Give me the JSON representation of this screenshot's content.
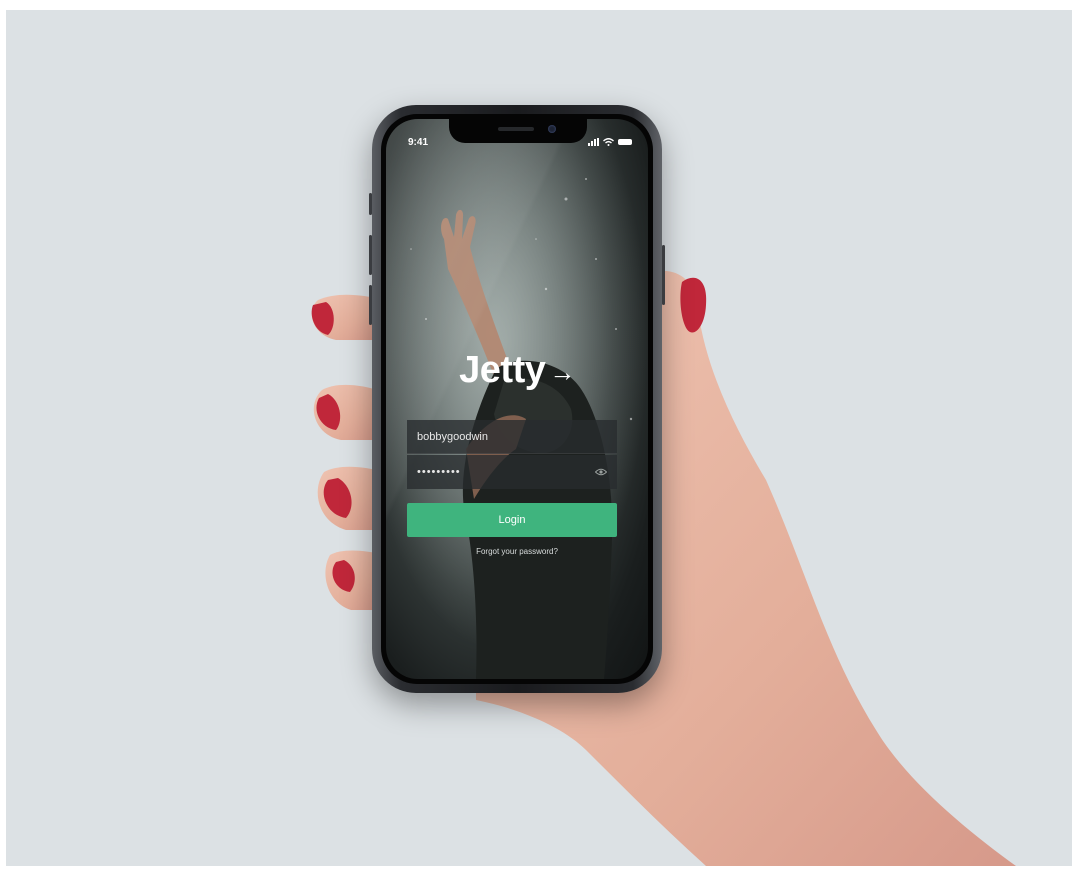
{
  "status_bar": {
    "time": "9:41"
  },
  "app": {
    "logo_text": "Jetty",
    "logo_arrow": "→"
  },
  "login_form": {
    "username_value": "bobbygoodwin",
    "password_value": "•••••••••",
    "login_label": "Login",
    "forgot_label": "Forgot your password?"
  },
  "icons": {
    "signal": "signal-icon",
    "wifi": "wifi-icon",
    "battery": "battery-icon",
    "password_visibility": "eye-icon"
  },
  "colors": {
    "accent": "#3fb47e",
    "background": "#dce1e4",
    "nail_polish": "#c0273a"
  }
}
